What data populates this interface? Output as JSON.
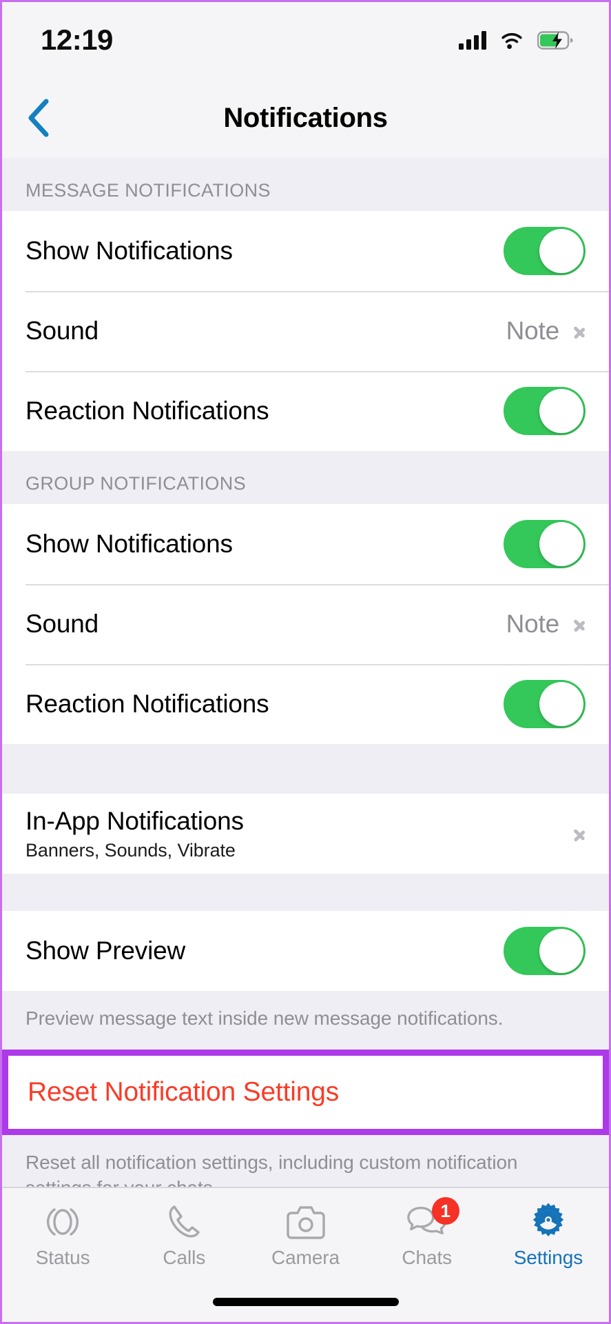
{
  "status_bar": {
    "time": "12:19",
    "cellular_icon": "cellular-signal-icon",
    "wifi_icon": "wifi-icon",
    "battery_icon": "battery-charging-icon"
  },
  "nav": {
    "back_icon": "chevron-left-icon",
    "title": "Notifications"
  },
  "sections": [
    {
      "header": "MESSAGE NOTIFICATIONS",
      "rows": [
        {
          "label": "Show Notifications",
          "type": "toggle",
          "value": "on"
        },
        {
          "label": "Sound",
          "type": "value",
          "value": "Note"
        },
        {
          "label": "Reaction Notifications",
          "type": "toggle",
          "value": "on"
        }
      ]
    },
    {
      "header": "GROUP NOTIFICATIONS",
      "rows": [
        {
          "label": "Show Notifications",
          "type": "toggle",
          "value": "on"
        },
        {
          "label": "Sound",
          "type": "value",
          "value": "Note"
        },
        {
          "label": "Reaction Notifications",
          "type": "toggle",
          "value": "on"
        }
      ]
    },
    {
      "header": "",
      "rows": [
        {
          "label": "In-App Notifications",
          "sublabel": "Banners, Sounds, Vibrate",
          "type": "disclosure"
        }
      ]
    },
    {
      "header": "",
      "rows": [
        {
          "label": "Show Preview",
          "type": "toggle",
          "value": "on"
        }
      ],
      "footer": "Preview message text inside new message notifications."
    }
  ],
  "reset": {
    "label": "Reset Notification Settings",
    "footer": "Reset all notification settings, including custom notification settings for your chats."
  },
  "tabbar": {
    "items": [
      {
        "label": "Status",
        "icon": "status-rings-icon",
        "active": false,
        "badge": ""
      },
      {
        "label": "Calls",
        "icon": "phone-icon",
        "active": false,
        "badge": ""
      },
      {
        "label": "Camera",
        "icon": "camera-icon",
        "active": false,
        "badge": ""
      },
      {
        "label": "Chats",
        "icon": "chat-bubbles-icon",
        "active": false,
        "badge": "1"
      },
      {
        "label": "Settings",
        "icon": "gear-icon",
        "active": true,
        "badge": ""
      }
    ]
  },
  "colors": {
    "toggle_on": "#34c759",
    "accent_blue": "#1673b8",
    "destructive_red": "#f93c28",
    "highlight_purple": "#ac3ae8",
    "badge_red": "#f63125"
  }
}
